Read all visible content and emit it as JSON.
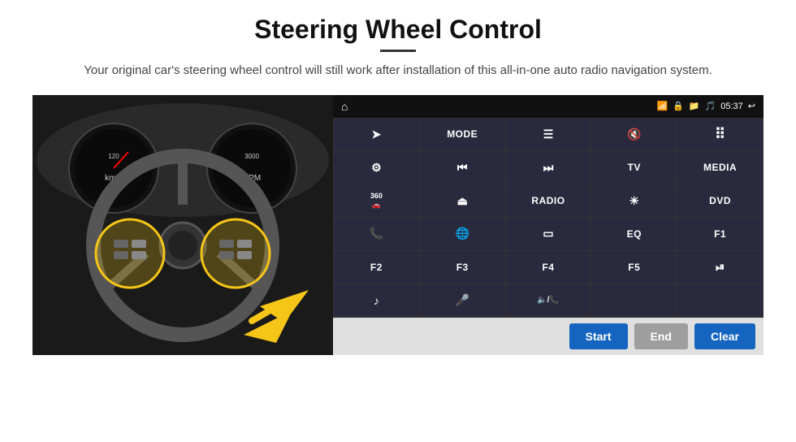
{
  "header": {
    "title": "Steering Wheel Control",
    "divider": true,
    "subtitle": "Your original car's steering wheel control will still work after installation of this all-in-one auto radio navigation system."
  },
  "android_ui": {
    "status_bar": {
      "time": "05:37",
      "icons": [
        "wifi",
        "lock",
        "sd",
        "bluetooth",
        "back"
      ]
    },
    "grid_buttons": [
      {
        "id": "btn-nav",
        "type": "icon",
        "icon": "➤",
        "label": "navigation"
      },
      {
        "id": "btn-mode",
        "type": "text",
        "text": "MODE"
      },
      {
        "id": "btn-list",
        "type": "icon",
        "icon": "≡",
        "label": "list"
      },
      {
        "id": "btn-mute",
        "type": "icon",
        "icon": "🔇",
        "label": "mute"
      },
      {
        "id": "btn-apps",
        "type": "icon",
        "icon": "⋯",
        "label": "apps"
      },
      {
        "id": "btn-settings",
        "type": "icon",
        "icon": "⚙",
        "label": "settings"
      },
      {
        "id": "btn-prev",
        "type": "icon",
        "icon": "⏮",
        "label": "previous"
      },
      {
        "id": "btn-next",
        "type": "icon",
        "icon": "⏭",
        "label": "next"
      },
      {
        "id": "btn-tv",
        "type": "text",
        "text": "TV"
      },
      {
        "id": "btn-media",
        "type": "text",
        "text": "MEDIA"
      },
      {
        "id": "btn-360",
        "type": "text",
        "text": "360",
        "sub": "camera"
      },
      {
        "id": "btn-eject",
        "type": "icon",
        "icon": "⏏",
        "label": "eject"
      },
      {
        "id": "btn-radio",
        "type": "text",
        "text": "RADIO"
      },
      {
        "id": "btn-brightness",
        "type": "icon",
        "icon": "☀",
        "label": "brightness"
      },
      {
        "id": "btn-dvd",
        "type": "text",
        "text": "DVD"
      },
      {
        "id": "btn-phone",
        "type": "icon",
        "icon": "📞",
        "label": "phone"
      },
      {
        "id": "btn-globe",
        "type": "icon",
        "icon": "🌐",
        "label": "browser"
      },
      {
        "id": "btn-screen",
        "type": "icon",
        "icon": "▭",
        "label": "screen"
      },
      {
        "id": "btn-eq",
        "type": "text",
        "text": "EQ"
      },
      {
        "id": "btn-f1",
        "type": "text",
        "text": "F1"
      },
      {
        "id": "btn-f2",
        "type": "text",
        "text": "F2"
      },
      {
        "id": "btn-f3",
        "type": "text",
        "text": "F3"
      },
      {
        "id": "btn-f4",
        "type": "text",
        "text": "F4"
      },
      {
        "id": "btn-f5",
        "type": "text",
        "text": "F5"
      },
      {
        "id": "btn-playpause",
        "type": "icon",
        "icon": "⏯",
        "label": "play-pause"
      },
      {
        "id": "btn-music",
        "type": "icon",
        "icon": "♪",
        "label": "music"
      },
      {
        "id": "btn-mic",
        "type": "icon",
        "icon": "🎤",
        "label": "microphone"
      },
      {
        "id": "btn-volphone",
        "type": "icon",
        "icon": "📵",
        "label": "vol-phone"
      },
      {
        "id": "btn-empty1",
        "type": "text",
        "text": ""
      },
      {
        "id": "btn-empty2",
        "type": "text",
        "text": ""
      }
    ],
    "action_buttons": {
      "start": "Start",
      "end": "End",
      "clear": "Clear"
    }
  }
}
